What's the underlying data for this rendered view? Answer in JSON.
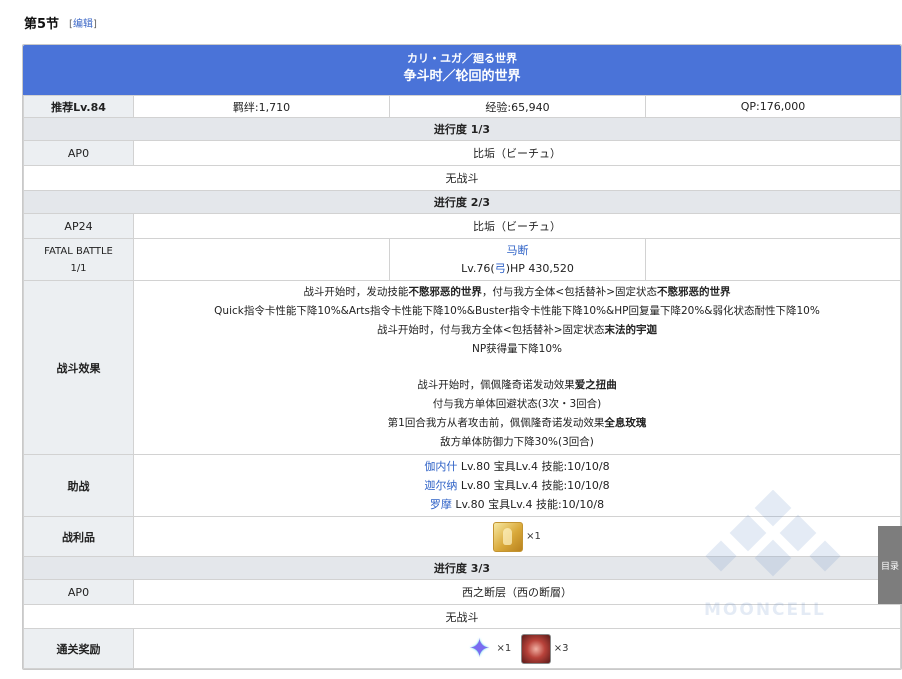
{
  "header": {
    "section_title": "第5节",
    "edit_open": "[",
    "edit_label": "编辑",
    "edit_close": "]"
  },
  "banner": {
    "title_jp": "カリ・ユガ／廻る世界",
    "title_cn": "争斗时／轮回的世界",
    "color": "#4a73d8"
  },
  "summary": {
    "recommended_level": "推荐Lv.84",
    "bond": "羁绊:1,710",
    "exp": "经验:65,940",
    "qp": "QP:176,000"
  },
  "progress": [
    {
      "title": "进行度 1/3",
      "ap": "AP0",
      "location": "比垢（ビーチュ）",
      "battle": "无战斗"
    },
    {
      "title": "进行度 2/3",
      "ap": "AP24",
      "location": "比垢（ビーチュ）",
      "fatal_label": "FATAL BATTLE",
      "fatal_count": "1/1",
      "enemy_name": "马断",
      "enemy_stats_prefix": "Lv.76(",
      "enemy_class": "弓",
      "enemy_stats_suffix": ")HP 430,520",
      "effects_label": "战斗效果",
      "effects": [
        {
          "a": "战斗开始时，发动技能",
          "b": "不愍邪恶的世界",
          "c": "，付与我方全体<包括替补>固定状态",
          "d": "不愍邪恶的世界"
        },
        {
          "a": "Quick指令卡性能下降10%&Arts指令卡性能下降10%&Buster指令卡性能下降10%&HP回复量下降20%&弱化状态耐性下降10%",
          "b": "",
          "c": "",
          "d": ""
        },
        {
          "a": "战斗开始时，付与我方全体<包括替补>固定状态",
          "b": "末法的宇迦",
          "c": "",
          "d": ""
        },
        {
          "a": "NP获得量下降10%",
          "b": "",
          "c": "",
          "d": ""
        },
        {
          "a": "战斗开始时，佩佩隆奇诺发动效果",
          "b": "爱之扭曲",
          "c": "",
          "d": ""
        },
        {
          "a": "付与我方单体回避状态(3次・3回合)",
          "b": "",
          "c": "",
          "d": ""
        },
        {
          "a": "第1回合我方从者攻击前，佩佩隆奇诺发动效果",
          "b": "全息玫瑰",
          "c": "",
          "d": ""
        },
        {
          "a": "敌方单体防御力下降30%(3回合)",
          "b": "",
          "c": "",
          "d": ""
        }
      ],
      "support_label": "助战",
      "supports": [
        {
          "name": "伽内什",
          "detail": " Lv.80 宝具Lv.4 技能:10/10/8"
        },
        {
          "name": "迦尔纳",
          "detail": " Lv.80 宝具Lv.4 技能:10/10/8"
        },
        {
          "name": "罗摩",
          "detail": " Lv.80 宝具Lv.4 技能:10/10/8"
        }
      ],
      "loot_label": "战利品",
      "loot": [
        {
          "icon": "gold-chest-icon",
          "count": "×1"
        }
      ]
    },
    {
      "title": "进行度 3/3",
      "ap": "AP0",
      "location": "西之断层（西の断層）",
      "battle": "无战斗"
    }
  ],
  "clear_reward": {
    "label": "通关奖励",
    "items": [
      {
        "icon": "saint-quartz-icon",
        "count": "×1"
      },
      {
        "icon": "red-material-icon",
        "count": "×3"
      }
    ]
  },
  "side_tab": {
    "label": "目录"
  },
  "watermark": {
    "text": "MOONCELL"
  }
}
